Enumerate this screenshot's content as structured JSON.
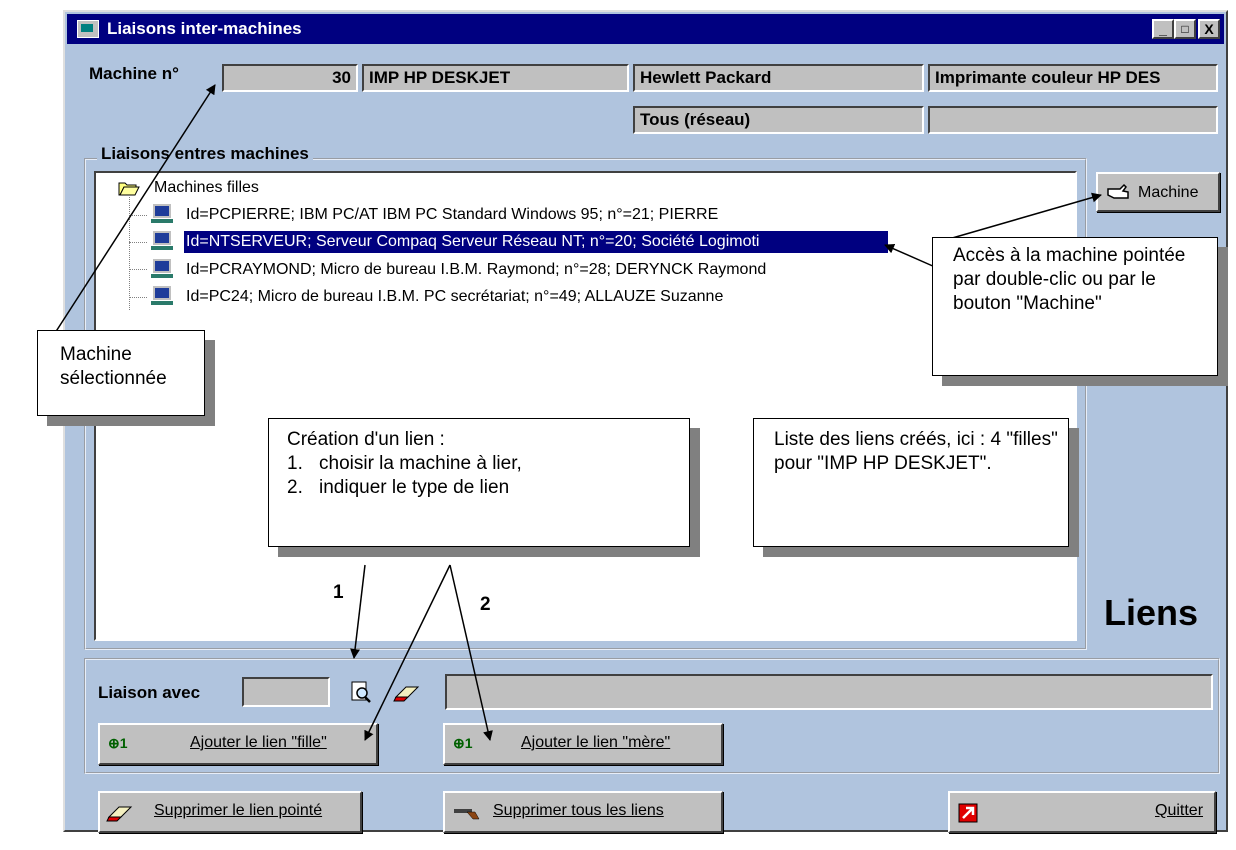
{
  "window": {
    "title": "Liaisons inter-machines",
    "min_label": "_",
    "max_label": "□",
    "close_label": "X"
  },
  "machine": {
    "label": "Machine n°",
    "number": "30",
    "name": "IMP HP DESKJET",
    "brand": "Hewlett Packard",
    "description": "Imprimante couleur HP DES",
    "scope": "Tous (réseau)",
    "extra": ""
  },
  "group": {
    "title": "Liaisons entres machines"
  },
  "tree": {
    "root": "Machines filles",
    "items": [
      {
        "label": "Id=PCPIERRE; IBM PC/AT IBM PC Standard Windows 95; n°=21; PIERRE",
        "selected": false
      },
      {
        "label": "Id=NTSERVEUR; Serveur Compaq Serveur Réseau NT; n°=20; Société Logimoti",
        "selected": true
      },
      {
        "label": "Id=PCRAYMOND; Micro de bureau I.B.M. Raymond; n°=28; DERYNCK Raymond",
        "selected": false
      },
      {
        "label": "Id=PC24; Micro de bureau I.B.M. PC secrétariat; n°=49; ALLAUZE Suzanne",
        "selected": false
      }
    ]
  },
  "machine_button": {
    "label": "Machine",
    "icon": "hand-pointer-icon"
  },
  "side_title": "Liens",
  "link": {
    "label": "Liaison avec",
    "value": "",
    "target": "",
    "search_icon": "magnifier-icon",
    "eraser_icon": "eraser-icon"
  },
  "buttons": {
    "add_child": "Ajouter le lien \"fille\"",
    "add_parent": "Ajouter le lien \"mère\"",
    "delete_one": "Supprimer le lien pointé",
    "delete_all": "Supprimer tous les liens",
    "quit": "Quitter",
    "add_icon_text": "⊕1"
  },
  "callouts": {
    "access": "Accès à la machine pointée par double-clic ou par le bouton \"Machine\"",
    "selected": "Machine sélectionnée",
    "creation_title": "Création d'un lien :",
    "creation_steps": [
      "choisir la machine à lier,",
      "indiquer le type de lien"
    ],
    "list": "Liste des liens créés, ici : 4 \"filles\" pour \"IMP HP DESKJET\"."
  },
  "markers": {
    "one": "1",
    "two": "2"
  },
  "colors": {
    "titlebar": "#000080",
    "window_bg": "#b0c4de",
    "selection": "#000080",
    "field_bg": "#c0c0c0"
  }
}
